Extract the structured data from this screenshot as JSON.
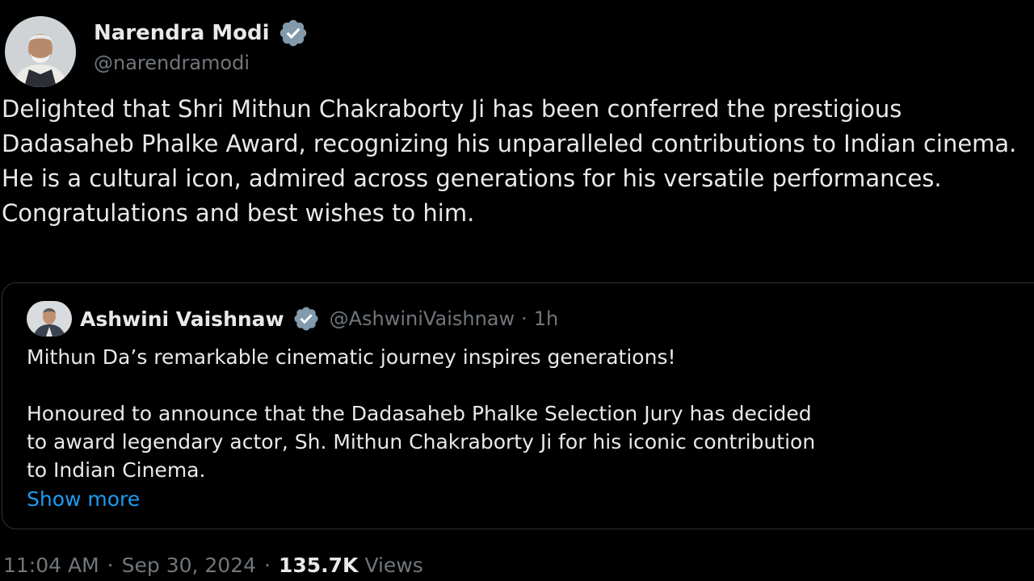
{
  "tweet": {
    "author": {
      "name": "Narendra Modi",
      "handle": "@narendramodi",
      "verified_color": "#829aab"
    },
    "text": "Delighted that Shri Mithun Chakraborty Ji has been conferred the prestigious Dadasaheb Phalke Award, recognizing his unparalleled contributions to Indian cinema. He is a cultural icon, admired across generations for his versatile performances. Congratulations and best wishes to him.",
    "quote": {
      "author_name": "Ashwini Vaishnaw",
      "handle": "@AshwiniVaishnaw",
      "separator": "·",
      "time": "1h",
      "lines": [
        "Mithun Da’s remarkable cinematic journey inspires generations!",
        "Honoured to announce that the Dadasaheb Phalke Selection Jury has decided",
        "to award legendary actor, Sh. Mithun Chakraborty Ji for his iconic contribution",
        "to Indian Cinema."
      ],
      "show_more": "Show more"
    },
    "meta": {
      "time": "11:04 AM",
      "separator": "·",
      "date": "Sep 30, 2024",
      "views_count": "135.7K",
      "views_label": "Views"
    }
  },
  "colors": {
    "background": "#000000",
    "text": "#e7e9ea",
    "secondary": "#71767b",
    "link": "#1d9bf0",
    "border": "#2f3336"
  },
  "icons": {
    "verified": "verified-badge-icon"
  }
}
